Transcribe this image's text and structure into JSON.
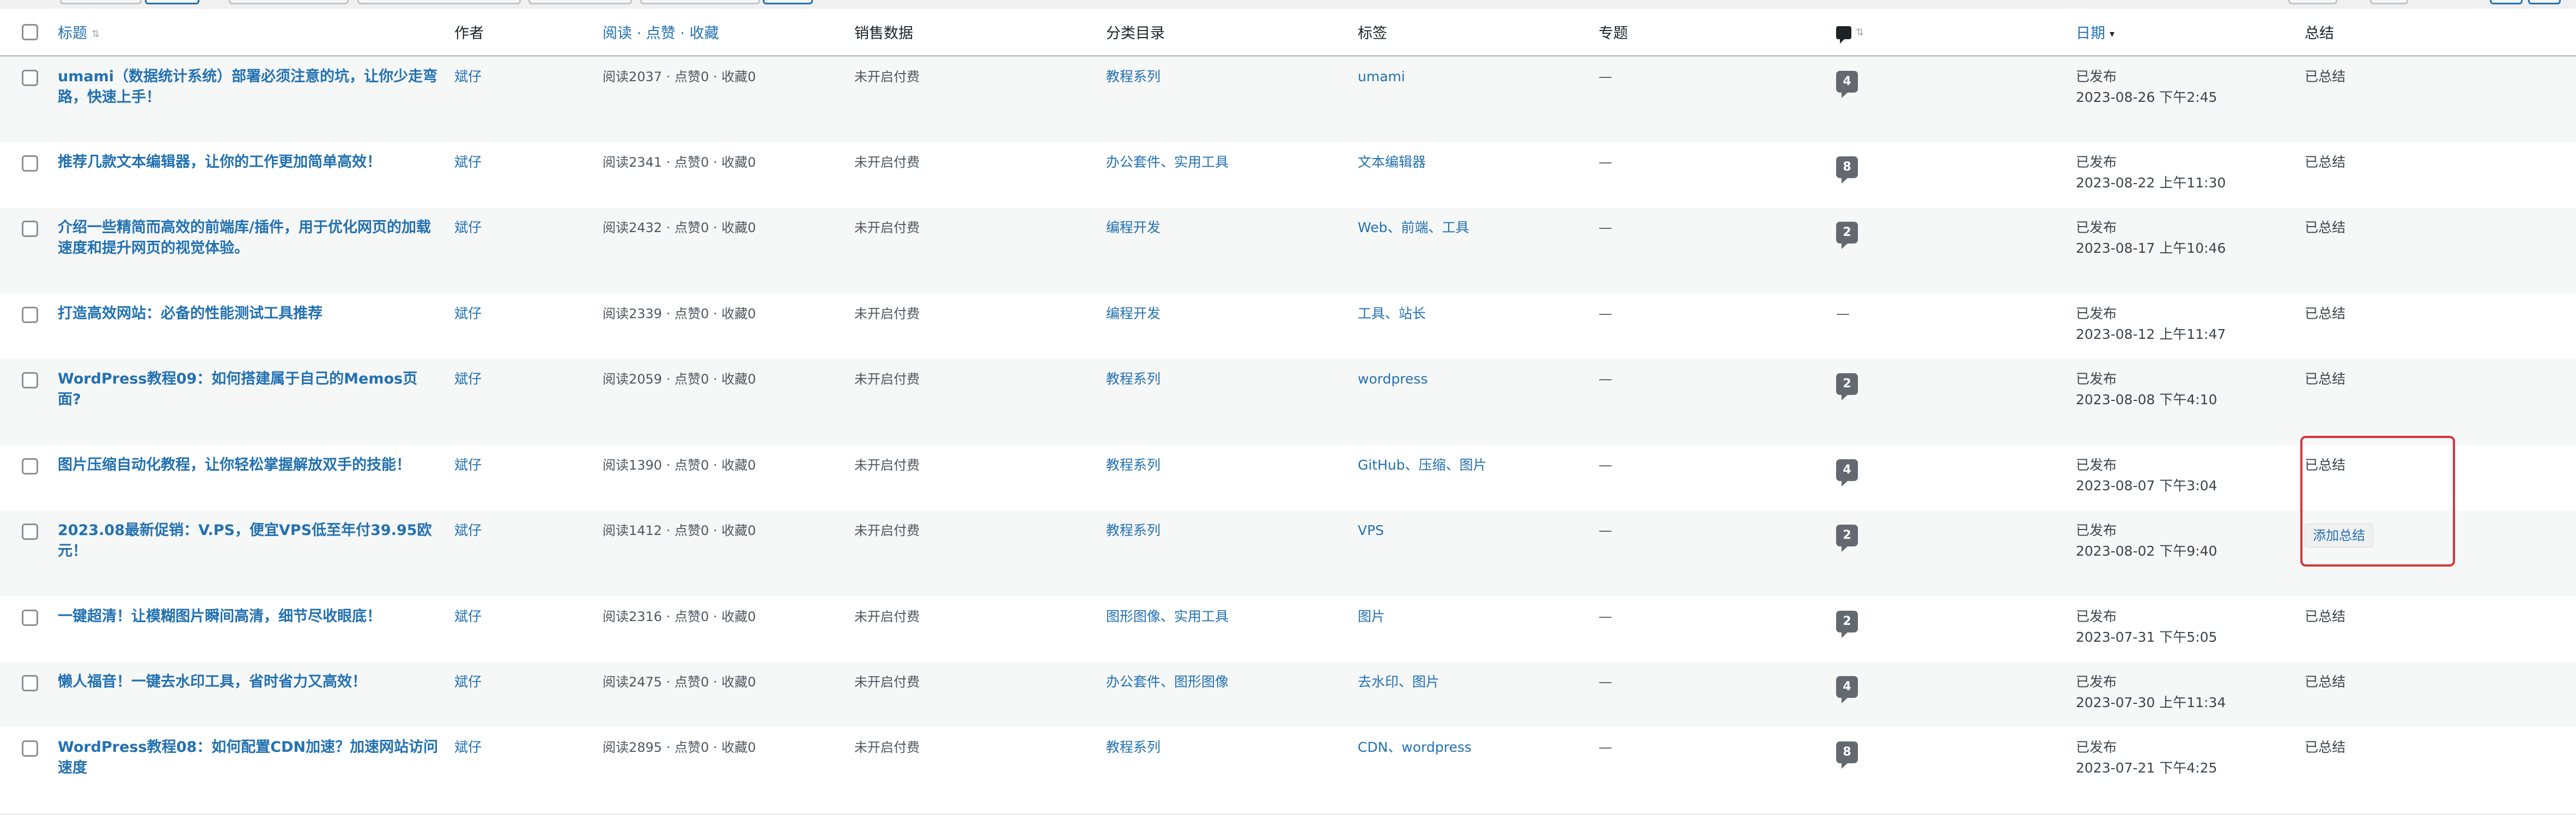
{
  "columns": {
    "title": "标题",
    "author": "作者",
    "views": "阅读 · 点赞 · 收藏",
    "sales": "销售数据",
    "categories": "分类目录",
    "tags": "标签",
    "topic": "专题",
    "date": "日期",
    "summary": "总结"
  },
  "colors": {
    "link": "#2271b1",
    "highlight_border": "#d63638",
    "comment_bubble": "#646970"
  },
  "icons": {
    "comments_header": "comment-bubble-icon",
    "sort": "sort-arrows-icon"
  },
  "posts": [
    {
      "title": "umami（数据统计系统）部署必须注意的坑，让你少走弯路，快速上手！",
      "author": "斌仔",
      "stats": "阅读2037 · 点赞0 · 收藏0",
      "sales": "未开启付费",
      "categories": "教程系列",
      "tags": "umami",
      "topic": "—",
      "comments": "4",
      "status": "已发布",
      "date": "2023-08-26 下午2:45",
      "summary": "已总结"
    },
    {
      "title": "推荐几款文本编辑器，让你的工作更加简单高效！",
      "author": "斌仔",
      "stats": "阅读2341 · 点赞0 · 收藏0",
      "sales": "未开启付费",
      "categories": "办公套件、实用工具",
      "tags": "文本编辑器",
      "topic": "—",
      "comments": "8",
      "status": "已发布",
      "date": "2023-08-22 上午11:30",
      "summary": "已总结"
    },
    {
      "title": "介绍一些精简而高效的前端库/插件，用于优化网页的加载速度和提升网页的视觉体验。",
      "author": "斌仔",
      "stats": "阅读2432 · 点赞0 · 收藏0",
      "sales": "未开启付费",
      "categories": "编程开发",
      "tags": "Web、前端、工具",
      "topic": "—",
      "comments": "2",
      "status": "已发布",
      "date": "2023-08-17 上午10:46",
      "summary": "已总结"
    },
    {
      "title": "打造高效网站：必备的性能测试工具推荐",
      "author": "斌仔",
      "stats": "阅读2339 · 点赞0 · 收藏0",
      "sales": "未开启付费",
      "categories": "编程开发",
      "tags": "工具、站长",
      "topic": "—",
      "comments": "—",
      "status": "已发布",
      "date": "2023-08-12 上午11:47",
      "summary": "已总结"
    },
    {
      "title": "WordPress教程09：如何搭建属于自己的Memos页面?",
      "author": "斌仔",
      "stats": "阅读2059 · 点赞0 · 收藏0",
      "sales": "未开启付费",
      "categories": "教程系列",
      "tags": "wordpress",
      "topic": "—",
      "comments": "2",
      "status": "已发布",
      "date": "2023-08-08 下午4:10",
      "summary": "已总结"
    },
    {
      "title": "图片压缩自动化教程，让你轻松掌握解放双手的技能！",
      "author": "斌仔",
      "stats": "阅读1390 · 点赞0 · 收藏0",
      "sales": "未开启付费",
      "categories": "教程系列",
      "tags": "GitHub、压缩、图片",
      "topic": "—",
      "comments": "4",
      "status": "已发布",
      "date": "2023-08-07 下午3:04",
      "summary": "已总结"
    },
    {
      "title": "2023.08最新促销：V.PS，便宜VPS低至年付39.95欧元！",
      "author": "斌仔",
      "stats": "阅读1412 · 点赞0 · 收藏0",
      "sales": "未开启付费",
      "categories": "教程系列",
      "tags": "VPS",
      "topic": "—",
      "comments": "2",
      "status": "已发布",
      "date": "2023-08-02 下午9:40",
      "summary": "添加总结"
    },
    {
      "title": "一键超清！让模糊图片瞬间高清，细节尽收眼底！",
      "author": "斌仔",
      "stats": "阅读2316 · 点赞0 · 收藏0",
      "sales": "未开启付费",
      "categories": "图形图像、实用工具",
      "tags": "图片",
      "topic": "—",
      "comments": "2",
      "status": "已发布",
      "date": "2023-07-31 下午5:05",
      "summary": "已总结"
    },
    {
      "title": "懒人福音！一键去水印工具，省时省力又高效！",
      "author": "斌仔",
      "stats": "阅读2475 · 点赞0 · 收藏0",
      "sales": "未开启付费",
      "categories": "办公套件、图形图像",
      "tags": "去水印、图片",
      "topic": "—",
      "comments": "4",
      "status": "已发布",
      "date": "2023-07-30 上午11:34",
      "summary": "已总结"
    },
    {
      "title": "WordPress教程08：如何配置CDN加速？加速网站访问速度",
      "author": "斌仔",
      "stats": "阅读2895 · 点赞0 · 收藏0",
      "sales": "未开启付费",
      "categories": "教程系列",
      "tags": "CDN、wordpress",
      "topic": "—",
      "comments": "8",
      "status": "已发布",
      "date": "2023-07-21 下午4:25",
      "summary": "已总结"
    }
  ]
}
